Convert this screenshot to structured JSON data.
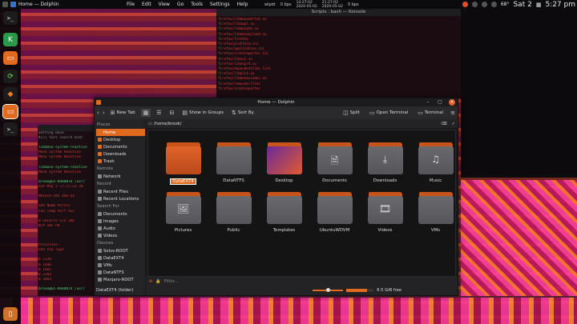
{
  "panel": {
    "app_name": "Home — Dolphin",
    "menu": [
      "File",
      "Edit",
      "View",
      "Go",
      "Tools",
      "Settings",
      "Help"
    ],
    "net_up": "14:27:02",
    "net_up_date": "2020-05-02",
    "net_down": "21:27:02",
    "net_down_date": "2020-05-02",
    "wallpaper_label": "wlpdr",
    "bps_up": "0 bps",
    "bps_down": "0 bps",
    "temp": "68°",
    "date": "Sat 2",
    "time": "5:27 pm"
  },
  "konsole": {
    "title": "Scripts : bash — Konsole",
    "lines": [
      "firefox/libmozwebrtch.so",
      "firefox/libnppl.so",
      "firefox/libmozgtk.so",
      "firefox/libmozwayland.so",
      "firefox/firefox",
      "firefox/platform.ini",
      "firefox/application.ini",
      "firefox/crashreporter.ini",
      "firefox/libxul.so",
      "firefox/libnspr4.so",
      "firefox/dependentlibs.list",
      "firefox/libplc4.so",
      "firefox/libmozavcodec.so",
      "firefox/removed-files",
      "firefox/crashreporter"
    ]
  },
  "terminal": {
    "lines": [
      "Setting  Done",
      "Kill text  search  bcdr",
      "",
      "libmono-system-reactive",
      "  Mono System Reactive",
      "  Mono System Reactive",
      "",
      "libmono-system-reactive",
      "  Mono System Reactive",
      "",
      "brook@G5-KUBUNTU /usr/",
      "Sat May  2 17:27:32 20",
      "",
      "  NVIDIA-SMI 440.64",
      "",
      "  GPU  Name    Persis",
      "  Fan  Temp  Perf  Pwr",
      "",
      "   0  GeForce GTX 106",
      "  N/A   58C    P0",
      "",
      "",
      "",
      "  Processes:",
      "   GPU      PID   Type",
      "",
      "     0     1339",
      "     0     1606",
      "     0     1981",
      "     0     2303",
      "     0     3463",
      "",
      "brook@G5-KUBUNTU /usr/"
    ]
  },
  "dolphin": {
    "title": "Home — Dolphin",
    "toolbar": {
      "new_tab": "New Tab",
      "show_in_groups": "Show in Groups",
      "sort_by": "Sort By",
      "split": "Split",
      "open_terminal": "Open Terminal",
      "terminal": "Terminal"
    },
    "path": "/home/brook/",
    "sidebar": {
      "places_header": "Places",
      "places": [
        "Home",
        "Desktop",
        "Documents",
        "Downloads",
        "Trash"
      ],
      "remote_header": "Remote",
      "remote": [
        "Network"
      ],
      "recent_header": "Recent",
      "recent": [
        "Recent Files",
        "Recent Locations"
      ],
      "search_header": "Search For",
      "search": [
        "Documents",
        "Images",
        "Audio",
        "Videos"
      ],
      "devices_header": "Devices",
      "devices": [
        "Solus-ROOT",
        "DataEXT4",
        "VMs",
        "DataNTFS",
        "Manjaro-ROOT"
      ]
    },
    "items": [
      {
        "label": "DataEXT4",
        "kind": "orange",
        "glyph": ""
      },
      {
        "label": "DataNTFS",
        "kind": "gray",
        "glyph": ""
      },
      {
        "label": "Desktop",
        "kind": "gradient",
        "glyph": ""
      },
      {
        "label": "Documents",
        "kind": "gray",
        "glyph": "🗎"
      },
      {
        "label": "Downloads",
        "kind": "gray",
        "glyph": "⤓"
      },
      {
        "label": "Music",
        "kind": "gray",
        "glyph": "♫"
      },
      {
        "label": "Pictures",
        "kind": "gray",
        "glyph": "🖼"
      },
      {
        "label": "Public",
        "kind": "gray",
        "glyph": ""
      },
      {
        "label": "Templates",
        "kind": "gray",
        "glyph": ""
      },
      {
        "label": "UbuntuWDVM",
        "kind": "gray",
        "glyph": ""
      },
      {
        "label": "Videos",
        "kind": "gray",
        "glyph": "🎞"
      },
      {
        "label": "VMs",
        "kind": "gray",
        "glyph": ""
      }
    ],
    "filter_placeholder": "Filter...",
    "status_text": "DataEXT4 (folder)",
    "free_space": "6.5 GiB free",
    "zoom_fraction": 0.5,
    "space_used_fraction": 0.75,
    "accent": "#e06a20"
  }
}
